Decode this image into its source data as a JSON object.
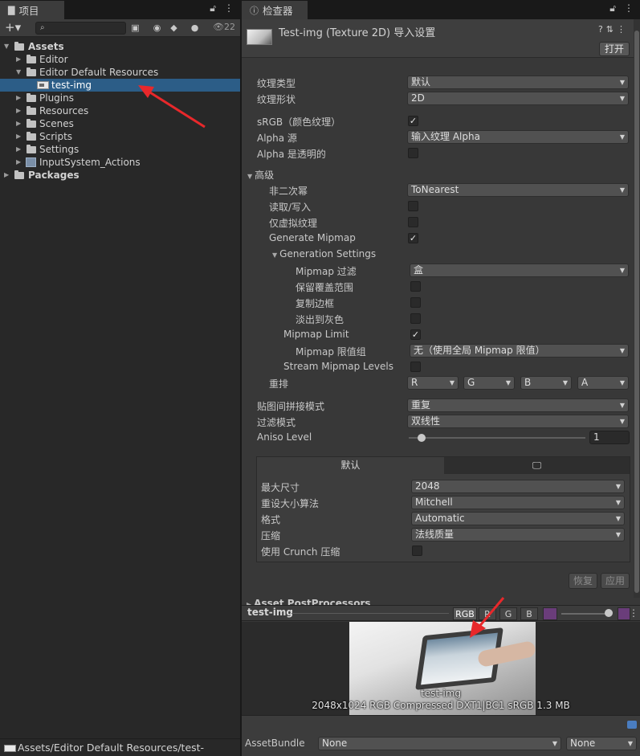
{
  "project": {
    "tab_label": "项目",
    "search_placeholder": "",
    "hidden_count": "22",
    "tree": {
      "assets": "Assets",
      "editor": "Editor",
      "editor_default_resources": "Editor Default Resources",
      "test_img": "test-img",
      "plugins": "Plugins",
      "resources": "Resources",
      "scenes": "Scenes",
      "scripts": "Scripts",
      "settings": "Settings",
      "input_actions": "InputSystem_Actions",
      "packages": "Packages"
    },
    "status_path": "Assets/Editor Default Resources/test-img.jpg"
  },
  "inspector": {
    "tab_label": "检查器",
    "title": "Test-img (Texture 2D) 导入设置",
    "open_button": "打开",
    "props": {
      "texture_type": {
        "label": "纹理类型",
        "value": "默认"
      },
      "texture_shape": {
        "label": "纹理形状",
        "value": "2D"
      },
      "srgb": {
        "label": "sRGB（颜色纹理）",
        "checked": true
      },
      "alpha_source": {
        "label": "Alpha 源",
        "value": "输入纹理 Alpha"
      },
      "alpha_transparency": {
        "label": "Alpha 是透明的",
        "checked": false
      },
      "advanced": {
        "label": "高级"
      },
      "npot": {
        "label": "非二次幂",
        "value": "ToNearest"
      },
      "read_write": {
        "label": "读取/写入",
        "checked": false
      },
      "virtual_texture": {
        "label": "仅虚拟纹理",
        "checked": false
      },
      "generate_mipmap": {
        "label": "Generate Mipmap",
        "checked": true
      },
      "generation_settings": {
        "label": "Generation Settings"
      },
      "mipmap_filter": {
        "label": "Mipmap 过滤",
        "value": "盒"
      },
      "preserve_coverage": {
        "label": "保留覆盖范围",
        "checked": false
      },
      "replicate_border": {
        "label": "复制边框",
        "checked": false
      },
      "fadeout": {
        "label": "淡出到灰色",
        "checked": false
      },
      "mipmap_limit": {
        "label": "Mipmap Limit",
        "checked": true
      },
      "mipmap_limit_group": {
        "label": "Mipmap 限值组",
        "value": "无（使用全局 Mipmap 限值）"
      },
      "stream_mipmap": {
        "label": "Stream Mipmap Levels",
        "checked": false
      },
      "swizzle": {
        "label": "重排",
        "r": "R",
        "g": "G",
        "b": "B",
        "a": "A"
      },
      "wrap_mode": {
        "label": "贴图间拼接模式",
        "value": "重复"
      },
      "filter_mode": {
        "label": "过滤模式",
        "value": "双线性"
      },
      "aniso_level": {
        "label": "Aniso Level",
        "value": "1",
        "slider_fraction": 0.0
      }
    },
    "platform": {
      "tab_default": "默认",
      "max_size": {
        "label": "最大尺寸",
        "value": "2048"
      },
      "resize_algorithm": {
        "label": "重设大小算法",
        "value": "Mitchell"
      },
      "format": {
        "label": "格式",
        "value": "Automatic"
      },
      "compression": {
        "label": "压缩",
        "value": "法线质量"
      },
      "crunch": {
        "label": "使用 Crunch 压缩",
        "checked": false
      }
    },
    "revert_button": "恢复",
    "apply_button": "应用",
    "postprocessors": "Asset PostProcessors",
    "preview": {
      "name": "test-img",
      "channels": [
        "RGB",
        "R",
        "G",
        "B"
      ],
      "active_channel": "RGB",
      "caption_name": "test-img",
      "caption_info": "2048x1024  RGB Compressed DXT1|BC1 sRGB   1.3 MB"
    },
    "assetbundle": {
      "label": "AssetBundle",
      "value": "None",
      "variant": "None"
    }
  },
  "colors": {
    "selection": "#2c5d87",
    "annotation_arrow": "#e8282b"
  }
}
